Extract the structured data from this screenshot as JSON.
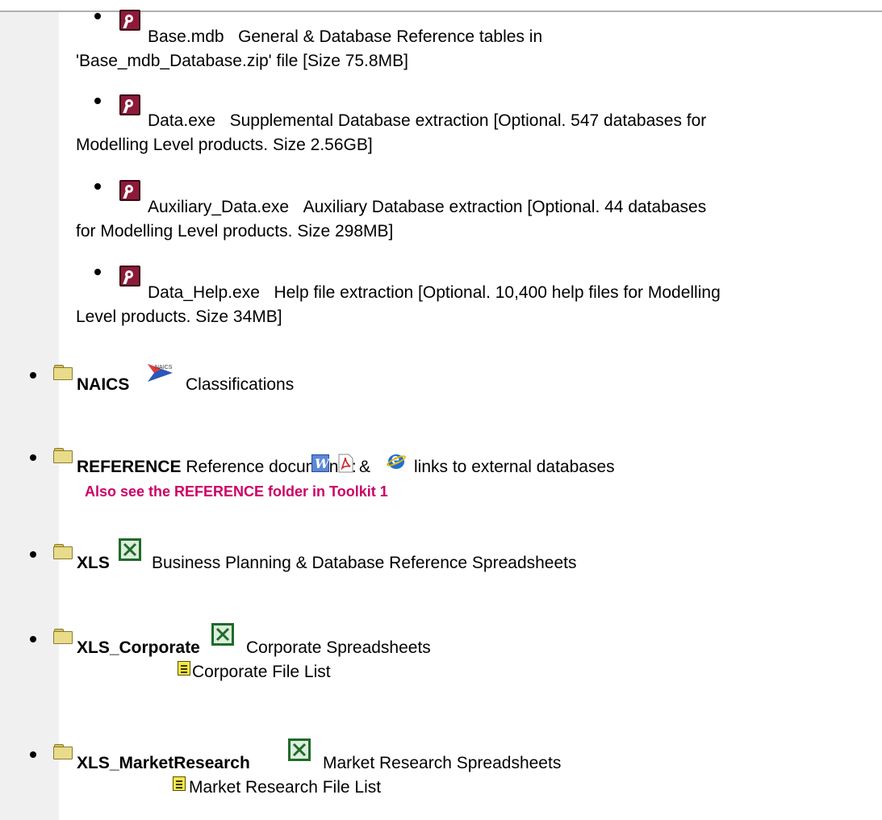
{
  "sub_items": [
    {
      "name": "Base.mdb",
      "desc1": "General & Database Reference tables in",
      "desc2": "'Base_mdb_Database.zip' file [Size 75.8MB]"
    },
    {
      "name": "Data.exe",
      "desc1": "Supplemental Database extraction [Optional. 547 databases for",
      "desc2": "Modelling Level products. Size 2.56GB]"
    },
    {
      "name": "Auxiliary_Data.exe",
      "desc1": "Auxiliary Database extraction [Optional. 44 databases",
      "desc2": "for Modelling Level products. Size 298MB]"
    },
    {
      "name": "Data_Help.exe",
      "desc1": "Help file extraction [Optional. 10,400 help files for Modelling",
      "desc2": "Level products. Size 34MB]"
    }
  ],
  "folders": {
    "naics": {
      "name": "NAICS",
      "desc": "Classifications",
      "icon": "naics-logo-icon"
    },
    "reference": {
      "name": "REFERENCE",
      "desc_prefix": "Reference documents:",
      "amp": "&",
      "desc_suffix": "links to external databases",
      "note": "Also see the REFERENCE folder in Toolkit 1",
      "note_color": "#cc0066"
    },
    "xls": {
      "name": "XLS",
      "desc": "Business Planning & Database Reference Spreadsheets"
    },
    "xls_corporate": {
      "name": "XLS_Corporate",
      "desc": "Corporate Spreadsheets",
      "file_list": "Corporate File List"
    },
    "xls_marketresearch": {
      "name": "XLS_MarketResearch",
      "desc": "Market Research Spreadsheets",
      "file_list": "Market Research File List"
    }
  }
}
